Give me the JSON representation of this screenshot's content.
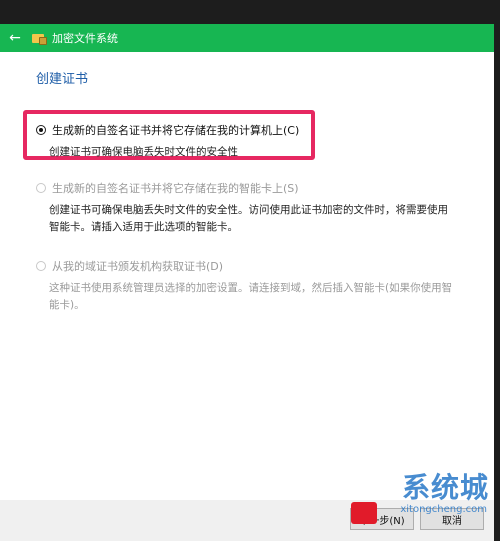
{
  "window": {
    "title": "加密文件系统",
    "icons": {
      "back": "back-arrow-icon",
      "app": "folder-lock-icon"
    }
  },
  "dialog": {
    "section_title": "创建证书",
    "options": [
      {
        "label": "生成新的自签名证书并将它存储在我的计算机上(C)",
        "description": "创建证书可确保电脑丢失时文件的安全性",
        "selected": true,
        "enabled": true
      },
      {
        "label": "生成新的自签名证书并将它存储在我的智能卡上(S)",
        "description": "创建证书可确保电脑丢失时文件的安全性。访问使用此证书加密的文件时，将需要使用智能卡。请插入适用于此选项的智能卡。",
        "selected": false,
        "enabled": false
      },
      {
        "label": "从我的域证书颁发机构获取证书(D)",
        "description": "这种证书使用系统管理员选择的加密设置。请连接到域，然后插入智能卡(如果你使用智能卡)。",
        "selected": false,
        "enabled": false
      }
    ],
    "highlight_color": "#e62861"
  },
  "footer": {
    "next_label": "下一步(N)",
    "cancel_label": "取消"
  },
  "watermark": {
    "main": "系统城",
    "sub": "xitongcheng.com"
  },
  "colors": {
    "titlebar": "#17b652",
    "section_title": "#1f5ea8"
  }
}
